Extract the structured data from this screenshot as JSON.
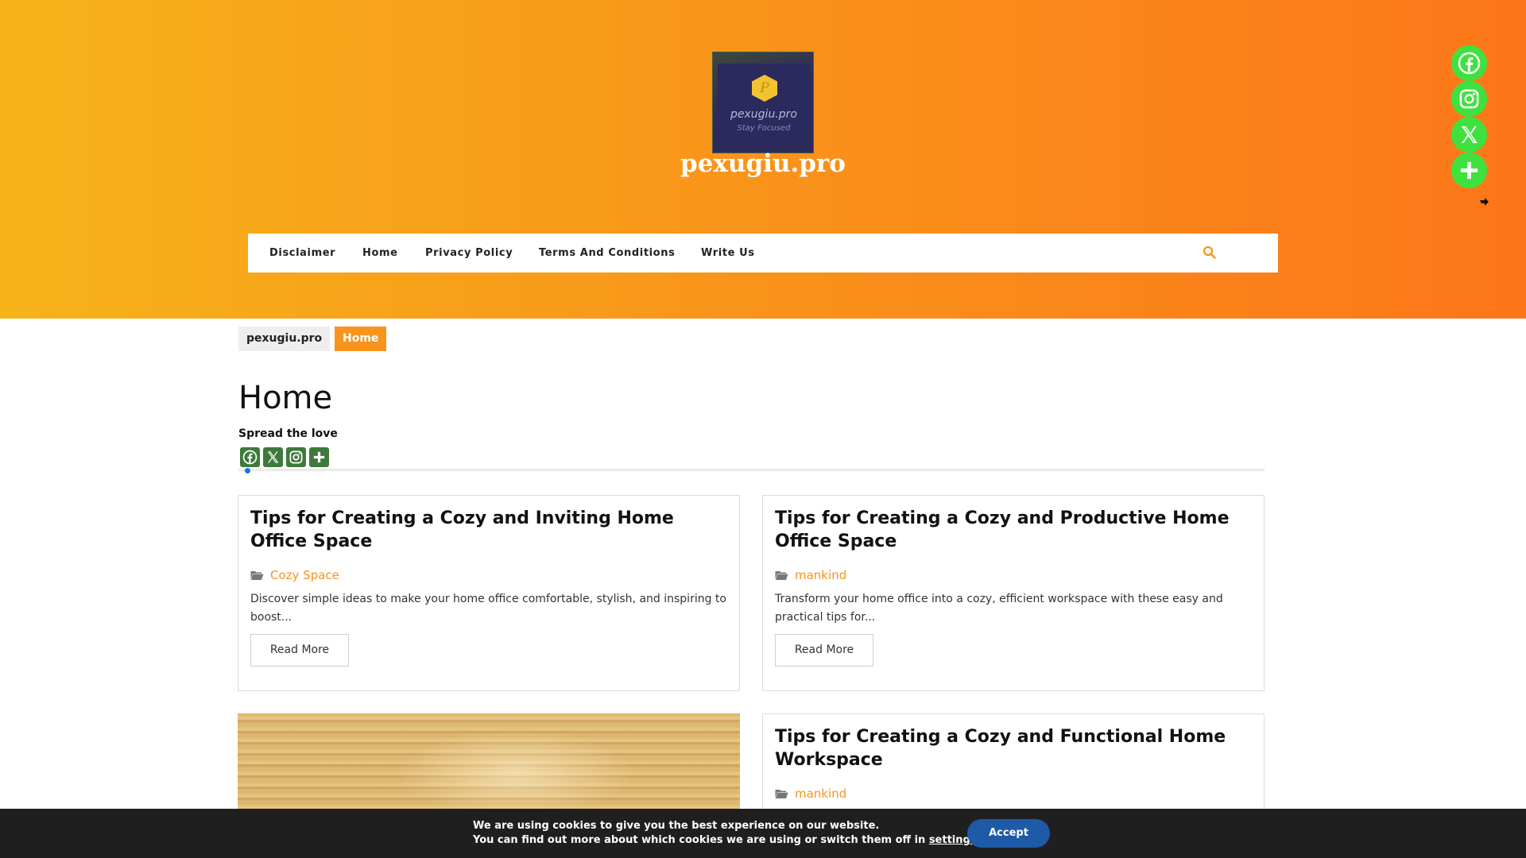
{
  "site": {
    "logo_name": "pexugiu.pro",
    "logo_tagline": "Stay Focused",
    "logo_letter": "P",
    "title": "pexugiu.pro"
  },
  "nav": {
    "items": [
      "Disclaimer",
      "Home",
      "Privacy Policy",
      "Terms And Conditions",
      "Write Us"
    ],
    "search_icon": "search-icon"
  },
  "floating_share": {
    "buttons": [
      "facebook-icon",
      "instagram-icon",
      "x-icon",
      "plus-icon"
    ],
    "hide_icon": "arrow-icon"
  },
  "breadcrumb": {
    "home": "pexugiu.pro",
    "current": "Home"
  },
  "page": {
    "title": "Home",
    "spread_label": "Spread the love",
    "share_buttons": [
      "facebook-icon",
      "x-icon",
      "instagram-icon",
      "plus-icon"
    ]
  },
  "posts": [
    {
      "title": "Tips for Creating a Cozy and Inviting Home Office Space",
      "category": "Cozy Space",
      "excerpt": "Discover simple ideas to make your home office comfortable, stylish, and inspiring to boost...",
      "read_more": "Read More"
    },
    {
      "title": "Tips for Creating a Cozy and Productive Home Office Space",
      "category": "mankind",
      "excerpt": "Transform your home office into a cozy, efficient workspace with these easy and practical tips for...",
      "read_more": "Read More"
    },
    {
      "title": "Tips for Creating a Cozy and Functional Home Workspace",
      "category": "mankind"
    }
  ],
  "cookie": {
    "line1": "We are using cookies to give you the best experience on our website.",
    "line2_prefix": "You can find out more about which cookies we are using or switch them off in ",
    "settings_link": "settings",
    "line2_suffix": ".",
    "accept": "Accept"
  },
  "colors": {
    "hero_start": "#f6b319",
    "hero_end": "#fd7619",
    "accent": "#f7941d",
    "share_green": "#3fe13f",
    "small_share": "#3e7a3b",
    "accept_button": "#1e5aa8",
    "cookie_bg": "#1f1f1f"
  }
}
